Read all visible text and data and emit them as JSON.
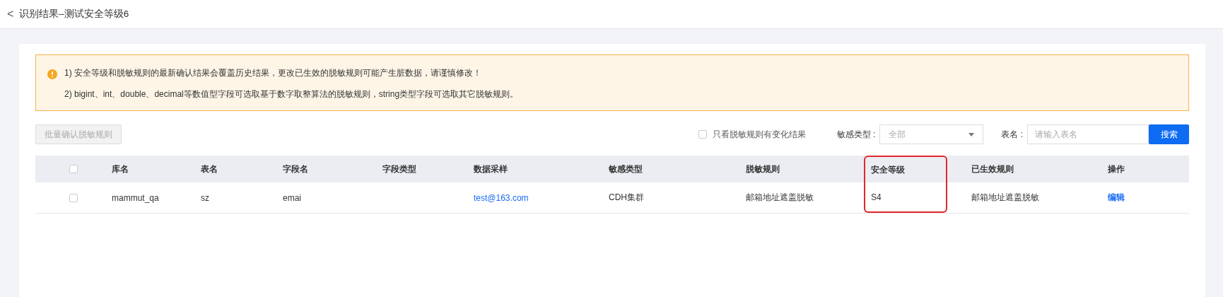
{
  "header": {
    "back_icon": "<",
    "title": "识别结果–测试安全等级6"
  },
  "notice": {
    "lines": [
      "1) 安全等级和脱敏规则的最新确认结果会覆盖历史结果，更改已生效的脱敏规则可能产生脏数据，请谨慎修改！",
      "2) bigint、int、double、decimal等数值型字段可选取基于数字取整算法的脱敏规则，string类型字段可选取其它脱敏规则。"
    ]
  },
  "toolbar": {
    "batch_button": {
      "label": "批量确认脱敏规则",
      "disabled": true
    },
    "changed_only": {
      "label": "只看脱敏规则有变化结果",
      "checked": false
    },
    "type_filter": {
      "label": "敏感类型 :",
      "value": "全部"
    },
    "table_name": {
      "label": "表名 :",
      "placeholder": "请输入表名"
    },
    "search_button": "搜索"
  },
  "table": {
    "select_all_checked": false,
    "columns": [
      {
        "label": "库名",
        "highlighted": false
      },
      {
        "label": "表名",
        "highlighted": false
      },
      {
        "label": "字段名",
        "highlighted": false
      },
      {
        "label": "字段类型",
        "highlighted": false
      },
      {
        "label": "数据采样",
        "highlighted": false
      },
      {
        "label": "敏感类型",
        "highlighted": false
      },
      {
        "label": "脱敏规则",
        "highlighted": false
      },
      {
        "label": "安全等级",
        "highlighted": true
      },
      {
        "label": "已生效规则",
        "highlighted": false
      },
      {
        "label": "操作",
        "highlighted": false
      }
    ],
    "rows": [
      {
        "checked": false,
        "cells": [
          {
            "kind": "text",
            "text": "mammut_qa"
          },
          {
            "kind": "text",
            "text": "sz"
          },
          {
            "kind": "text",
            "text": "emai"
          },
          {
            "kind": "empty"
          },
          {
            "kind": "link",
            "text": "test@163.com"
          },
          {
            "kind": "text",
            "text": "CDH集群"
          },
          {
            "kind": "text",
            "text": "邮箱地址遮盖脱敏"
          },
          {
            "kind": "text",
            "text": "S4"
          },
          {
            "kind": "text",
            "text": "邮箱地址遮盖脱敏"
          },
          {
            "kind": "action",
            "text": "编辑"
          }
        ]
      }
    ]
  }
}
